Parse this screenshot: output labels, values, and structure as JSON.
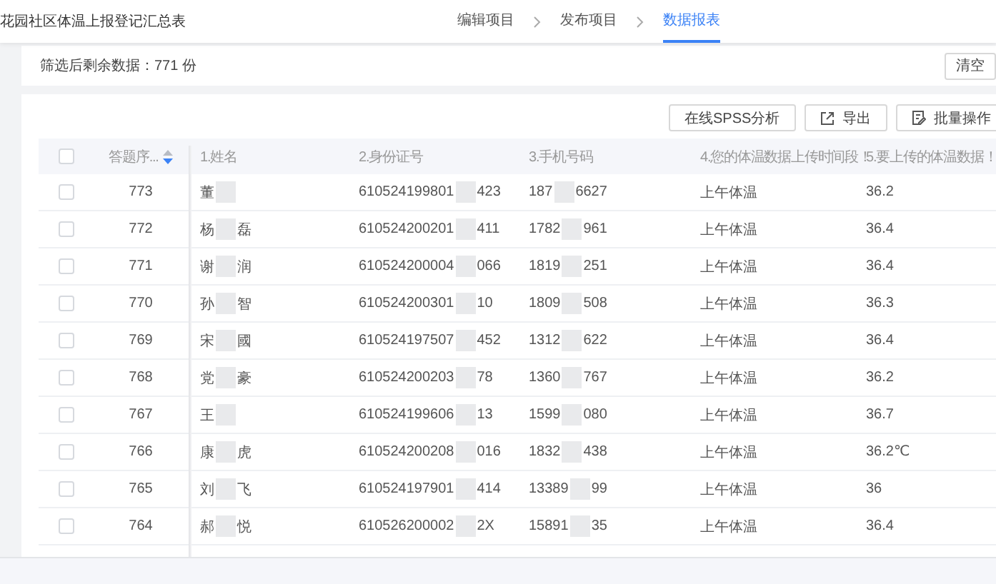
{
  "header": {
    "title": "花园社区体温上报登记汇总表",
    "steps": [
      {
        "label": "编辑项目",
        "selected": false
      },
      {
        "label": "发布项目",
        "selected": false
      },
      {
        "label": "数据报表",
        "selected": true
      }
    ]
  },
  "filter": {
    "summary": "筛选后剩余数据：771 份",
    "clear_button": "清空"
  },
  "toolbar": [
    {
      "kind": "plain",
      "label": "在线SPSS分析"
    },
    {
      "kind": "export",
      "label": "导出"
    },
    {
      "kind": "edit",
      "label": "批量操作"
    },
    {
      "kind": "blank"
    }
  ],
  "table": {
    "all_checked": false,
    "columns": [
      {
        "label": "答题序...",
        "sort_descending": true
      },
      {
        "label": "1.姓名"
      },
      {
        "label": "2.身份证号"
      },
      {
        "label": "3.手机号码"
      },
      {
        "label": "4.您的体温数据上传时间段！"
      },
      {
        "label": "5.要上传的体温数据！"
      }
    ],
    "rows": [
      {
        "checked": false,
        "seq": "773",
        "name": [
          "董"
        ],
        "id_number": [
          "610524199801",
          "423"
        ],
        "phone": [
          "187",
          "6627"
        ],
        "period": "上午体温",
        "temperature": "36.2"
      },
      {
        "checked": false,
        "seq": "772",
        "name": [
          "杨",
          "磊"
        ],
        "id_number": [
          "610524200201",
          "411"
        ],
        "phone": [
          "1782",
          "961"
        ],
        "period": "上午体温",
        "temperature": "36.4"
      },
      {
        "checked": false,
        "seq": "771",
        "name": [
          "谢",
          "润"
        ],
        "id_number": [
          "610524200004",
          "066"
        ],
        "phone": [
          "1819",
          "251"
        ],
        "period": "上午体温",
        "temperature": "36.4"
      },
      {
        "checked": false,
        "seq": "770",
        "name": [
          "孙",
          "智"
        ],
        "id_number": [
          "610524200301",
          "10"
        ],
        "phone": [
          "1809",
          "508"
        ],
        "period": "上午体温",
        "temperature": "36.3"
      },
      {
        "checked": false,
        "seq": "769",
        "name": [
          "宋",
          "國"
        ],
        "id_number": [
          "610524197507",
          "452"
        ],
        "phone": [
          "1312",
          "622"
        ],
        "period": "上午体温",
        "temperature": "36.4"
      },
      {
        "checked": false,
        "seq": "768",
        "name": [
          "党",
          "豪"
        ],
        "id_number": [
          "610524200203",
          "78"
        ],
        "phone": [
          "1360",
          "767"
        ],
        "period": "上午体温",
        "temperature": "36.2"
      },
      {
        "checked": false,
        "seq": "767",
        "name": [
          "王"
        ],
        "id_number": [
          "610524199606",
          "13"
        ],
        "phone": [
          "1599",
          "080"
        ],
        "period": "上午体温",
        "temperature": "36.7"
      },
      {
        "checked": false,
        "seq": "766",
        "name": [
          "康",
          "虎"
        ],
        "id_number": [
          "610524200208",
          "016"
        ],
        "phone": [
          "1832",
          "438"
        ],
        "period": "上午体温",
        "temperature": "36.2℃"
      },
      {
        "checked": false,
        "seq": "765",
        "name": [
          "刘",
          "飞"
        ],
        "id_number": [
          "610524197901",
          "414"
        ],
        "phone": [
          "13389",
          "99"
        ],
        "period": "上午体温",
        "temperature": "36"
      },
      {
        "checked": false,
        "seq": "764",
        "name": [
          "郝",
          "悦"
        ],
        "id_number": [
          "610526200002",
          "2X"
        ],
        "phone": [
          "15891",
          "35"
        ],
        "period": "上午体温",
        "temperature": "36.4"
      }
    ]
  }
}
